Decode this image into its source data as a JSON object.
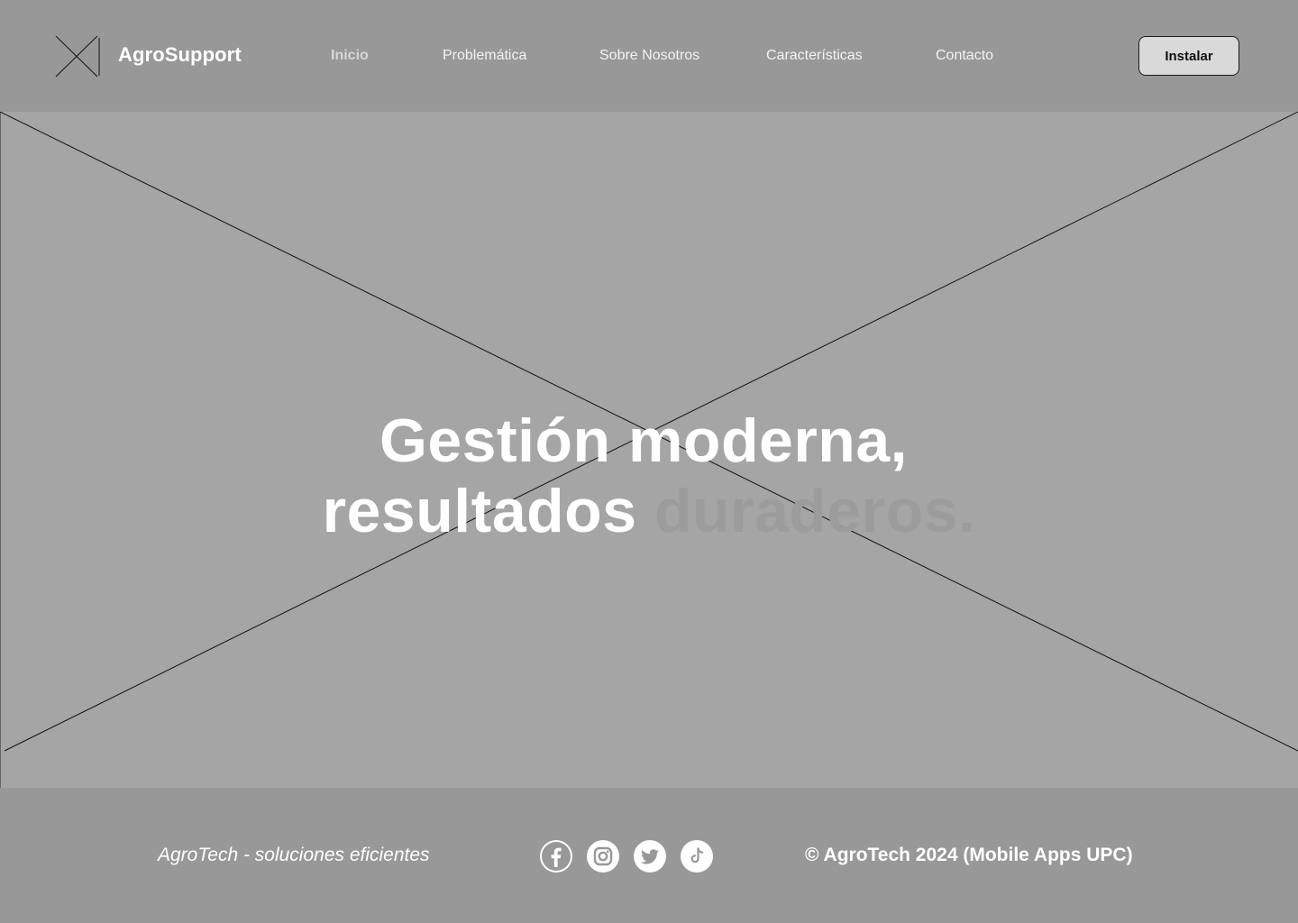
{
  "header": {
    "brand": "AgroSupport",
    "nav": [
      {
        "label": "Inicio",
        "active": true
      },
      {
        "label": "Problemática",
        "active": false
      },
      {
        "label": "Sobre Nosotros",
        "active": false
      },
      {
        "label": "Características",
        "active": false
      },
      {
        "label": "Contacto",
        "active": false
      }
    ],
    "install_label": "Instalar"
  },
  "hero": {
    "line1": "Gestión moderna,",
    "line2_main": "resultados",
    "line2_muted": "duraderos.",
    "image": "image-placeholder"
  },
  "footer": {
    "tagline": "AgroTech - soluciones eficientes",
    "social_icons": [
      "facebook-icon",
      "instagram-icon",
      "twitter-icon",
      "tiktok-icon"
    ],
    "copyright": "© AgroTech 2024 (Mobile Apps UPC)"
  },
  "colors": {
    "header_bg": "#989898",
    "hero_bg": "#a5a5a5",
    "footer_bg": "#989898",
    "text_white": "#ffffff",
    "muted_text": "#9c9c9c",
    "button_bg": "#d9d9d9"
  }
}
